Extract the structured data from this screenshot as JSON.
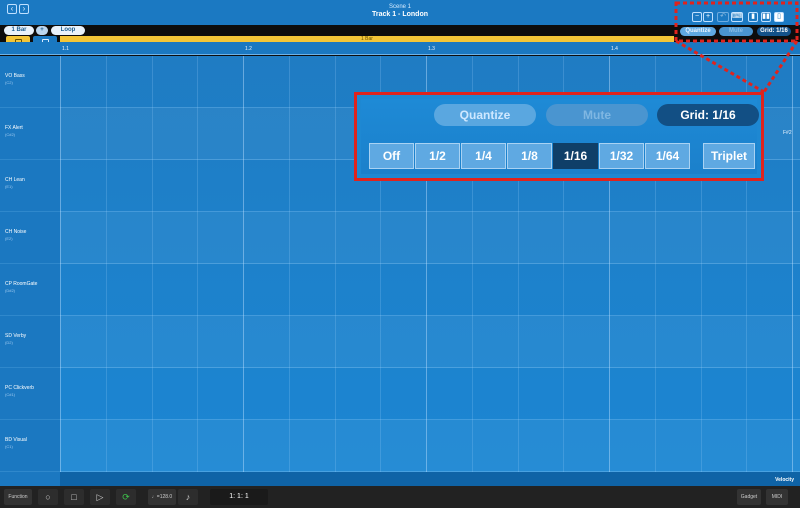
{
  "header": {
    "scene": "Scene 1",
    "track": "Track 1 - London"
  },
  "left_pills": {
    "bar": "1 Bar",
    "plus": "+",
    "loop": "Loop"
  },
  "tools": {
    "draw": "Draw",
    "select": "Select"
  },
  "ruler": {
    "strip_label": "1 Bar",
    "ticks": [
      "1.1",
      "1.2",
      "1.3",
      "1.4"
    ]
  },
  "toolbar": {
    "quantize": "Quantize",
    "mute": "Mute",
    "grid": "Grid: 1/16",
    "undo_glyph": "↶"
  },
  "keys": [
    {
      "name": "VO Bass",
      "note": "(C2)"
    },
    {
      "name": "FX Alert",
      "note": "(C#2)"
    },
    {
      "name": "CH Lean",
      "note": "(E1)"
    },
    {
      "name": "CH Noise",
      "note": "(E2)"
    },
    {
      "name": "CP RoomGate",
      "note": "(D#2)"
    },
    {
      "name": "SD Verby",
      "note": "(D2)"
    },
    {
      "name": "PC Clickverb",
      "note": "(C#1)"
    },
    {
      "name": "BD Visual",
      "note": "(C1)"
    }
  ],
  "grid_edge_label": "F#2",
  "velocity_label": "Velocity",
  "callout": {
    "quantize": "Quantize",
    "mute": "Mute",
    "grid": "Grid: 1/16",
    "options": [
      "Off",
      "1/2",
      "1/4",
      "1/8",
      "1/16",
      "1/32",
      "1/64"
    ],
    "triplet": "Triplet",
    "selected": "1/16"
  },
  "bottom": {
    "function": "Function",
    "tempo": "♩=128.0",
    "position": "1:   1:   1",
    "gadget": "Gadget",
    "midi": "MIDI"
  },
  "colors": {
    "accent": "#1b79c2",
    "highlight": "#f3c537",
    "callout_border": "#e0231d",
    "selected": "#0f3f68"
  }
}
